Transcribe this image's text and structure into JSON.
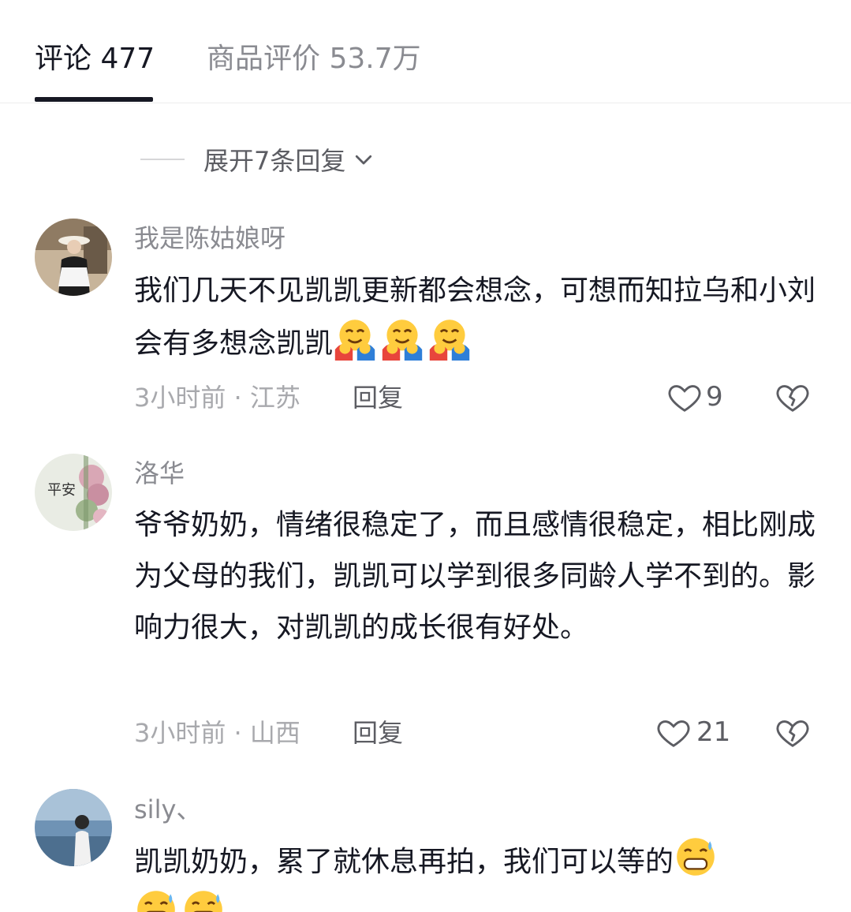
{
  "tabs": {
    "comments_label": "评论 477",
    "reviews_label": "商品评价 53.7万"
  },
  "expand_replies": "展开7条回复",
  "comments": [
    {
      "username": "我是陈姑娘呀",
      "text": "我们几天不见凯凯更新都会想念，可想而知拉乌和小刘会有多想念凯凯",
      "time_location": "3小时前 · 江苏",
      "reply": "回复",
      "likes": "9"
    },
    {
      "username": "洛华",
      "text": "爷爷奶奶，情绪很稳定了，而且感情很稳定，相比刚成为父母的我们，凯凯可以学到很多同龄人学不到的。影响力很大，对凯凯的成长很有好处。",
      "time_location": "3小时前 · 山西",
      "reply": "回复",
      "likes": "21"
    },
    {
      "username": "sily、",
      "text": "凯凯奶奶，累了就休息再拍，我们可以等的",
      "time_location": "",
      "reply": "",
      "likes": ""
    }
  ],
  "icons": {
    "like": "heart-outline-icon",
    "dislike": "broken-heart-icon",
    "expand": "chevron-down-icon",
    "hug_emoji": "hugging-face-emoji",
    "sweat_emoji": "grinning-sweat-emoji"
  },
  "colors": {
    "primary_text": "#161823",
    "secondary_text": "#8a8b91",
    "tertiary_text": "#a8a9ad"
  }
}
